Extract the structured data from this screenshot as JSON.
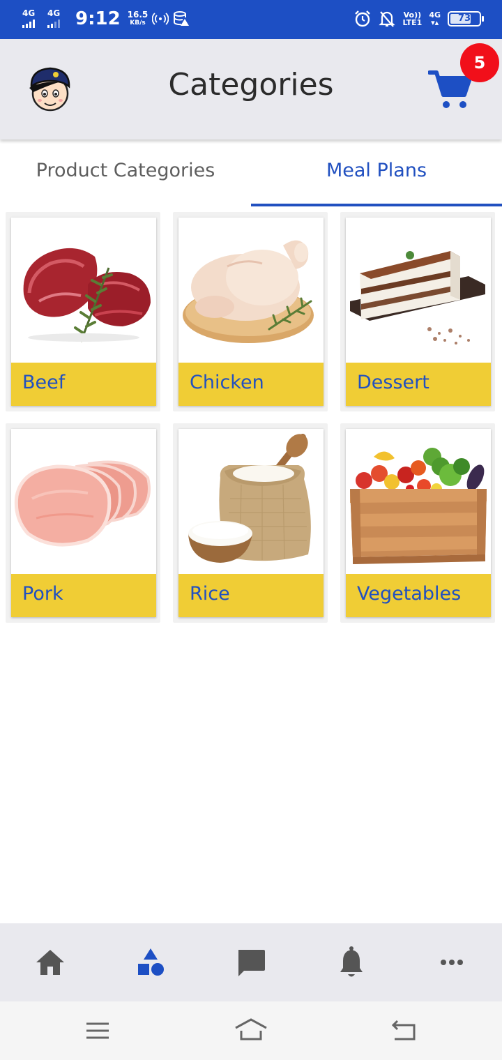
{
  "status_bar": {
    "network_1": "4G",
    "network_2": "4G",
    "time": "9:12",
    "speed_value": "16.5",
    "speed_unit": "KB/s",
    "volte_label": "Vo))",
    "lte_label": "LTE1",
    "network_3": "4G",
    "battery_level": "73",
    "icons": [
      "signal-icon",
      "hotspot-icon",
      "data-saver-icon",
      "alarm-icon",
      "mute-icon",
      "battery-icon"
    ]
  },
  "header": {
    "title": "Categories",
    "cart_count": "5",
    "accent_color": "#1d4fc4",
    "badge_color": "#f10f1a"
  },
  "tabs": [
    {
      "label": "Product Categories",
      "active": false
    },
    {
      "label": "Meal Plans",
      "active": true
    }
  ],
  "categories": [
    {
      "label": "Beef",
      "image": "beef-image"
    },
    {
      "label": "Chicken",
      "image": "chicken-image"
    },
    {
      "label": "Dessert",
      "image": "dessert-image"
    },
    {
      "label": "Pork",
      "image": "pork-image"
    },
    {
      "label": "Rice",
      "image": "rice-image"
    },
    {
      "label": "Vegetables",
      "image": "vegetables-image"
    }
  ],
  "label_background": "#f0cd35",
  "bottom_nav": {
    "items": [
      "home-icon",
      "categories-icon",
      "chat-icon",
      "bell-icon",
      "more-icon"
    ],
    "active": "categories-icon"
  },
  "system_nav": [
    "menu-icon",
    "home-icon",
    "back-icon"
  ]
}
